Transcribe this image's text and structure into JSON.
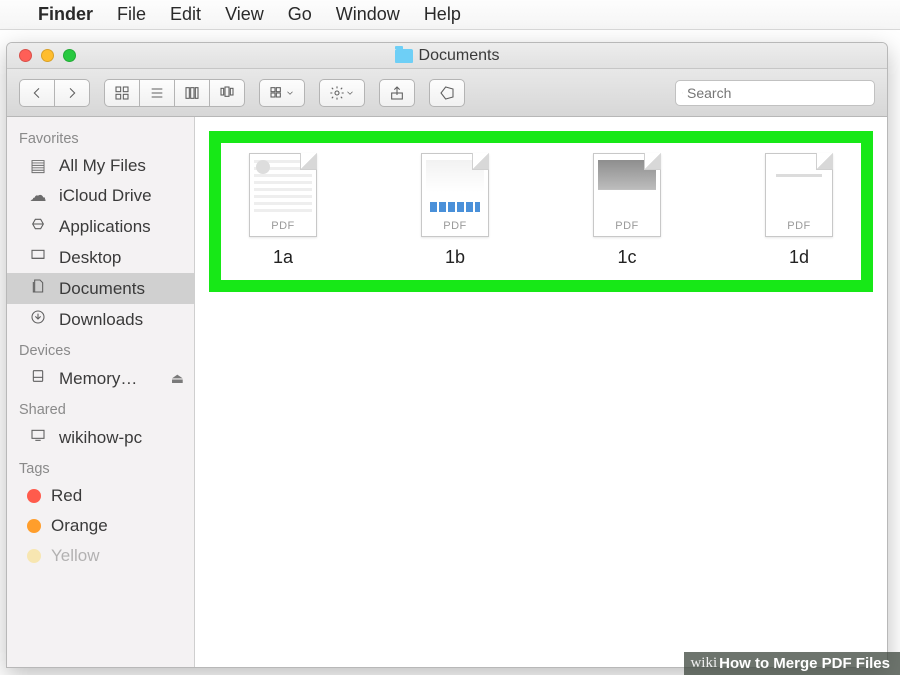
{
  "menubar": {
    "app_name": "Finder",
    "items": [
      "File",
      "Edit",
      "View",
      "Go",
      "Window",
      "Help"
    ]
  },
  "window": {
    "title": "Documents"
  },
  "toolbar": {
    "search_placeholder": "Search"
  },
  "sidebar": {
    "sections": [
      {
        "title": "Favorites",
        "items": [
          {
            "label": "All My Files",
            "icon": "all-files-icon",
            "selected": false
          },
          {
            "label": "iCloud Drive",
            "icon": "cloud-icon",
            "selected": false
          },
          {
            "label": "Applications",
            "icon": "applications-icon",
            "selected": false
          },
          {
            "label": "Desktop",
            "icon": "desktop-icon",
            "selected": false
          },
          {
            "label": "Documents",
            "icon": "documents-icon",
            "selected": true
          },
          {
            "label": "Downloads",
            "icon": "downloads-icon",
            "selected": false
          }
        ]
      },
      {
        "title": "Devices",
        "items": [
          {
            "label": "Memory…",
            "icon": "drive-icon",
            "eject": true
          }
        ]
      },
      {
        "title": "Shared",
        "items": [
          {
            "label": "wikihow-pc",
            "icon": "computer-icon"
          }
        ]
      },
      {
        "title": "Tags",
        "items": [
          {
            "label": "Red",
            "icon": "tag-dot",
            "color": "#ff5b4c"
          },
          {
            "label": "Orange",
            "icon": "tag-dot",
            "color": "#ff9e2c"
          },
          {
            "label": "Yellow",
            "icon": "tag-dot",
            "color": "#ffd23a"
          }
        ]
      }
    ]
  },
  "files": [
    {
      "label": "1a",
      "badge": "PDF"
    },
    {
      "label": "1b",
      "badge": "PDF"
    },
    {
      "label": "1c",
      "badge": "PDF"
    },
    {
      "label": "1d",
      "badge": "PDF"
    }
  ],
  "watermark": {
    "brand_prefix": "wiki",
    "brand_suffix": "How to Merge PDF Files"
  }
}
